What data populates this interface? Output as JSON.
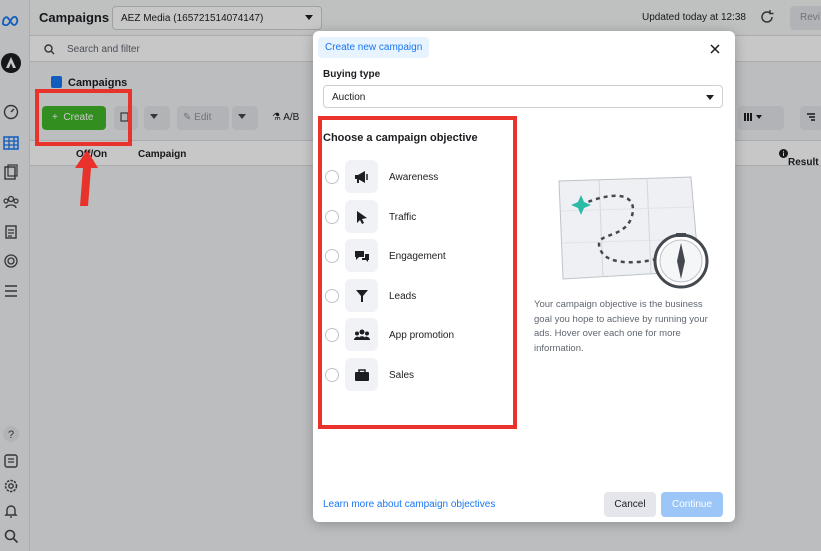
{
  "header": {
    "title": "Campaigns",
    "account": "AEZ Media (165721514074147)",
    "updated": "Updated today at 12:38",
    "review_label": "Revi"
  },
  "search": {
    "placeholder": "Search and filter"
  },
  "background": {
    "tab_campaigns": "Campaigns",
    "create_label": "Create",
    "edit_label": "Edit",
    "ab_label": "A/B",
    "columns": {
      "onoff": "Off/On",
      "campaign": "Campaign",
      "results": "Result"
    }
  },
  "modal": {
    "tab_label": "Create new campaign",
    "buying_type_label": "Buying type",
    "buying_type_value": "Auction",
    "objective_heading": "Choose a campaign objective",
    "objectives": [
      {
        "label": "Awareness",
        "icon": "megaphone-icon"
      },
      {
        "label": "Traffic",
        "icon": "cursor-icon"
      },
      {
        "label": "Engagement",
        "icon": "chat-bubbles-icon"
      },
      {
        "label": "Leads",
        "icon": "funnel-icon"
      },
      {
        "label": "App promotion",
        "icon": "people-icon"
      },
      {
        "label": "Sales",
        "icon": "briefcase-icon"
      }
    ],
    "description": "Your campaign objective is the business goal you hope to achieve by running your ads. Hover over each one for more information.",
    "learn_more": "Learn more about campaign objectives",
    "cancel_label": "Cancel",
    "continue_label": "Continue"
  },
  "colors": {
    "accent": "#1877f2",
    "create_green": "#42b72a",
    "annotation_red": "#e8322b",
    "illustration_teal": "#2abba7"
  }
}
